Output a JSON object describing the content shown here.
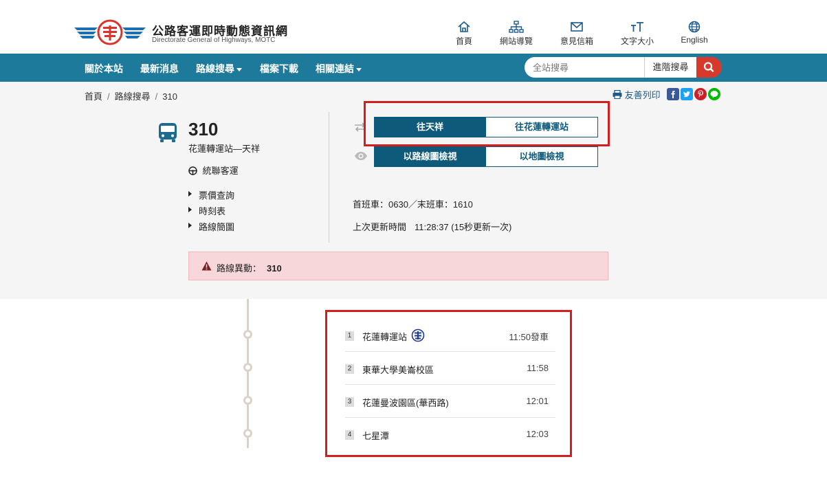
{
  "header": {
    "title": "公路客運即時動態資訊網",
    "subtitle": "Directorate General of Highways, MOTC",
    "toplinks": [
      {
        "label": "首頁",
        "icon": "home-icon"
      },
      {
        "label": "網站導覽",
        "icon": "sitemap-icon"
      },
      {
        "label": "意見信箱",
        "icon": "mail-icon"
      },
      {
        "label": "文字大小",
        "icon": "font-size-icon"
      },
      {
        "label": "English",
        "icon": "globe-icon"
      }
    ]
  },
  "nav": {
    "items": [
      "關於本站",
      "最新消息",
      "路線搜尋",
      "檔案下載",
      "相關連結"
    ],
    "search_placeholder": "全站搜尋",
    "advanced_search": "進階搜尋"
  },
  "breadcrumb": [
    "首頁",
    "路線搜尋",
    "310"
  ],
  "print_label": "友善列印",
  "route": {
    "number": "310",
    "name": "花蓮轉運站—天祥",
    "operator": "統聯客運",
    "side_links": [
      "票價查詢",
      "時刻表",
      "路線簡圖"
    ]
  },
  "direction": {
    "options": [
      "往天祥",
      "往花蓮轉運站"
    ],
    "selected": 0
  },
  "view": {
    "options": [
      "以路線圖檢視",
      "以地圖檢視"
    ],
    "selected": 0
  },
  "schedule": {
    "first_last": "首班車：0630／末班車：1610",
    "last_update_label": "上次更新時間",
    "last_update_value": "11:28:37 (15秒更新一次)"
  },
  "alert": {
    "label": "路線異動：",
    "value": "310"
  },
  "stops": [
    {
      "seq": "1",
      "name": "花蓮轉運站",
      "time": "11:50發車",
      "rail": true
    },
    {
      "seq": "2",
      "name": "東華大學美崙校區",
      "time": "11:58",
      "rail": false
    },
    {
      "seq": "3",
      "name": "花蓮曼波園區(華西路)",
      "time": "12:01",
      "rail": false
    },
    {
      "seq": "4",
      "name": "七星潭",
      "time": "12:03",
      "rail": false
    }
  ],
  "colors": {
    "nav_bg": "#1d7a9a",
    "primary": "#0d5a7a",
    "alert_bg": "#f8d7da",
    "highlight": "#d41e1e"
  }
}
